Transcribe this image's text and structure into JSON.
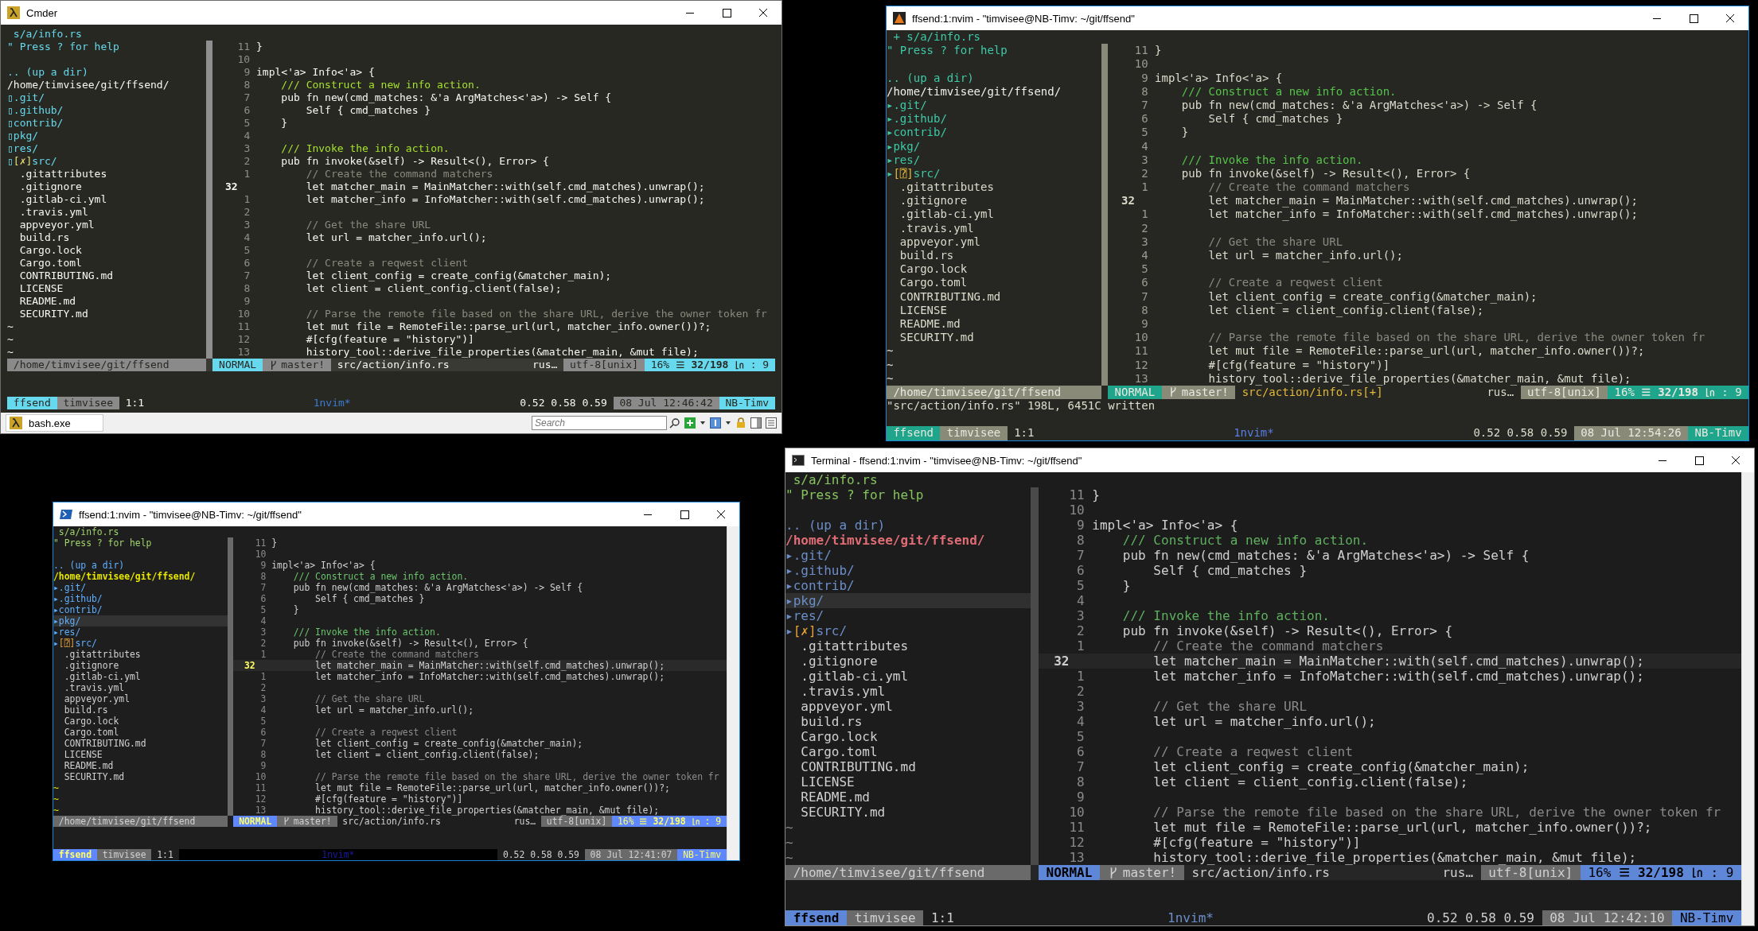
{
  "windows": [
    {
      "kind": "cmder",
      "title": "Cmder",
      "buffer_label": "s/a/info.rs",
      "tree": {
        "help": "\" Press ? for help",
        "parent": ".. (up a dir)",
        "root": "/home/timvisee/git/ffsend/",
        "items": [
          {
            "kind": "dir",
            "marker": "▯",
            "name": ".git/"
          },
          {
            "kind": "dir",
            "marker": "▯",
            "name": ".github/"
          },
          {
            "kind": "dir",
            "marker": "▯",
            "name": "contrib/"
          },
          {
            "kind": "dir",
            "marker": "▯",
            "name": "pkg/"
          },
          {
            "kind": "dir",
            "marker": "▯",
            "name": "res/"
          },
          {
            "kind": "dir",
            "marker": "▯",
            "flag": "[✗]",
            "name": "src/"
          },
          {
            "kind": "file",
            "name": ".gitattributes"
          },
          {
            "kind": "file",
            "name": ".gitignore"
          },
          {
            "kind": "file",
            "name": ".gitlab-ci.yml"
          },
          {
            "kind": "file",
            "name": ".travis.yml"
          },
          {
            "kind": "file",
            "name": "appveyor.yml"
          },
          {
            "kind": "file",
            "name": "build.rs"
          },
          {
            "kind": "file",
            "name": "Cargo.lock"
          },
          {
            "kind": "file",
            "name": "Cargo.toml"
          },
          {
            "kind": "file",
            "name": "CONTRIBUTING.md"
          },
          {
            "kind": "file",
            "name": "LICENSE"
          },
          {
            "kind": "file",
            "name": "README.md"
          },
          {
            "kind": "file",
            "name": "SECURITY.md"
          }
        ],
        "empty_lines": [
          "~",
          "~",
          "~"
        ]
      },
      "code": [
        {
          "number": "11",
          "kind": "code",
          "text": "}",
          "current": false
        },
        {
          "number": "10",
          "current": false
        },
        {
          "number": "9",
          "kind": "code",
          "text": "impl<'a> Info<'a> {",
          "current": false
        },
        {
          "number": "8",
          "kind": "doc",
          "text": "    /// Construct a new info action.",
          "current": false
        },
        {
          "number": "7",
          "kind": "code",
          "text": "    pub fn new(cmd_matches: &'a ArgMatches<'a>) -> Self {",
          "current": false
        },
        {
          "number": "6",
          "kind": "code",
          "text": "        Self { cmd_matches }",
          "current": false
        },
        {
          "number": "5",
          "kind": "code",
          "text": "    }",
          "current": false
        },
        {
          "number": "4",
          "current": false
        },
        {
          "number": "3",
          "kind": "doc",
          "text": "    /// Invoke the info action.",
          "current": false
        },
        {
          "number": "2",
          "kind": "code",
          "text": "    pub fn invoke(&self) -> Result<(), Error> {",
          "current": false
        },
        {
          "number": "1",
          "kind": "comment",
          "text": "        // Create the command matchers",
          "current": false
        },
        {
          "number": "32",
          "kind": "code",
          "text": "        let matcher_main = MainMatcher::with(self.cmd_matches).unwrap();",
          "current": true
        },
        {
          "number": "1",
          "kind": "code",
          "text": "        let matcher_info = InfoMatcher::with(self.cmd_matches).unwrap();",
          "current": false
        },
        {
          "number": "2",
          "current": false
        },
        {
          "number": "3",
          "kind": "comment",
          "text": "        // Get the share URL",
          "current": false
        },
        {
          "number": "4",
          "kind": "code",
          "text": "        let url = matcher_info.url();",
          "current": false
        },
        {
          "number": "5",
          "current": false
        },
        {
          "number": "6",
          "kind": "comment",
          "text": "        // Create a reqwest client",
          "current": false
        },
        {
          "number": "7",
          "kind": "code",
          "text": "        let client_config = create_config(&matcher_main);",
          "current": false
        },
        {
          "number": "8",
          "kind": "code",
          "text": "        let client = client_config.client(false);",
          "current": false
        },
        {
          "number": "9",
          "current": false
        },
        {
          "number": "10",
          "kind": "comment",
          "text": "        // Parse the remote file based on the share URL, derive the owner token fr",
          "current": false
        },
        {
          "number": "11",
          "kind": "code",
          "text": "        let mut file = RemoteFile::parse_url(url, matcher_info.owner())?;",
          "current": false
        },
        {
          "number": "12",
          "kind": "code",
          "text": "        #[cfg(feature = \"history\")]",
          "current": false
        },
        {
          "number": "13",
          "kind": "code",
          "text": "        history_tool::derive_file_properties(&matcher_main, &mut file);",
          "current": false
        }
      ],
      "status": {
        "tree_path": "/home/timvisee/git/ffsend",
        "mode": "NORMAL",
        "branch": "master!",
        "file": "src/action/info.rs",
        "filetype": "rus…",
        "encoding": "utf-8[unix]",
        "percent": "16%",
        "position": "32/198",
        "separator": ":",
        "column": "9"
      },
      "tmux": {
        "session": "ffsend",
        "user": "timvisee",
        "pane": "1:1",
        "window": "1nvim*",
        "load": "0.52 0.58 0.59",
        "clock": "08 Jul 12:46:42",
        "host": "NB-Timv"
      },
      "taskbar": {
        "tab": "bash.exe",
        "search_placeholder": "Search"
      }
    },
    {
      "kind": "mintty",
      "title": "ffsend:1:nvim - \"timvisee@NB-Timv: ~/git/ffsend\"",
      "buffer_label": "+ s/a/info.rs",
      "tree": {
        "help": "\" Press ? for help",
        "parent": ".. (up a dir)",
        "root": "/home/timvisee/git/ffsend/",
        "items": [
          {
            "kind": "dir",
            "marker": "▸",
            "name": ".git/"
          },
          {
            "kind": "dir",
            "marker": "▸",
            "name": ".github/"
          },
          {
            "kind": "dir",
            "marker": "▸",
            "name": "contrib/"
          },
          {
            "kind": "dir",
            "marker": "▸",
            "name": "pkg/"
          },
          {
            "kind": "dir",
            "marker": "▸",
            "name": "res/"
          },
          {
            "kind": "dir",
            "marker": "▸",
            "flag": "[⍰]",
            "name": "src/"
          },
          {
            "kind": "file",
            "name": ".gitattributes"
          },
          {
            "kind": "file",
            "name": ".gitignore"
          },
          {
            "kind": "file",
            "name": ".gitlab-ci.yml"
          },
          {
            "kind": "file",
            "name": ".travis.yml"
          },
          {
            "kind": "file",
            "name": "appveyor.yml"
          },
          {
            "kind": "file",
            "name": "build.rs"
          },
          {
            "kind": "file",
            "name": "Cargo.lock"
          },
          {
            "kind": "file",
            "name": "Cargo.toml"
          },
          {
            "kind": "file",
            "name": "CONTRIBUTING.md"
          },
          {
            "kind": "file",
            "name": "LICENSE"
          },
          {
            "kind": "file",
            "name": "README.md"
          },
          {
            "kind": "file",
            "name": "SECURITY.md"
          }
        ],
        "empty_lines": [
          "~",
          "~",
          "~"
        ]
      },
      "code": [
        {
          "number": "11",
          "kind": "code",
          "text": "}",
          "current": false
        },
        {
          "number": "10",
          "current": false
        },
        {
          "number": "9",
          "kind": "code",
          "text": "impl<'a> Info<'a> {",
          "current": false
        },
        {
          "number": "8",
          "kind": "doc",
          "text": "    /// Construct a new info action.",
          "current": false
        },
        {
          "number": "7",
          "kind": "code",
          "text": "    pub fn new(cmd_matches: &'a ArgMatches<'a>) -> Self {",
          "current": false
        },
        {
          "number": "6",
          "kind": "code",
          "text": "        Self { cmd_matches }",
          "current": false
        },
        {
          "number": "5",
          "kind": "code",
          "text": "    }",
          "current": false
        },
        {
          "number": "4",
          "current": false
        },
        {
          "number": "3",
          "kind": "doc",
          "text": "    /// Invoke the info action.",
          "current": false
        },
        {
          "number": "2",
          "kind": "code",
          "text": "    pub fn invoke(&self) -> Result<(), Error> {",
          "current": false
        },
        {
          "number": "1",
          "kind": "comment",
          "text": "        // Create the command matchers",
          "current": false
        },
        {
          "number": "32",
          "kind": "code",
          "text": "        let matcher_main = MainMatcher::with(self.cmd_matches).unwrap();",
          "current": true
        },
        {
          "number": "1",
          "kind": "code",
          "text": "        let matcher_info = InfoMatcher::with(self.cmd_matches).unwrap();",
          "current": false
        },
        {
          "number": "2",
          "current": false
        },
        {
          "number": "3",
          "kind": "comment",
          "text": "        // Get the share URL",
          "current": false
        },
        {
          "number": "4",
          "kind": "code",
          "text": "        let url = matcher_info.url();",
          "current": false
        },
        {
          "number": "5",
          "current": false
        },
        {
          "number": "6",
          "kind": "comment",
          "text": "        // Create a reqwest client",
          "current": false
        },
        {
          "number": "7",
          "kind": "code",
          "text": "        let client_config = create_config(&matcher_main);",
          "current": false
        },
        {
          "number": "8",
          "kind": "code",
          "text": "        let client = client_config.client(false);",
          "current": false
        },
        {
          "number": "9",
          "current": false
        },
        {
          "number": "10",
          "kind": "comment",
          "text": "        // Parse the remote file based on the share URL, derive the owner token fr",
          "current": false
        },
        {
          "number": "11",
          "kind": "code",
          "text": "        let mut file = RemoteFile::parse_url(url, matcher_info.owner())?;",
          "current": false
        },
        {
          "number": "12",
          "kind": "code",
          "text": "        #[cfg(feature = \"history\")]",
          "current": false
        },
        {
          "number": "13",
          "kind": "code",
          "text": "        history_tool::derive_file_properties(&matcher_main, &mut file);",
          "current": false
        }
      ],
      "status": {
        "tree_path": "/home/timvisee/git/ffsend",
        "mode": "NORMAL",
        "branch": "master!",
        "file": "src/action/info.rs[+]",
        "filetype": "rus…",
        "encoding": "utf-8[unix]",
        "percent": "16%",
        "position": "32/198",
        "separator": ":",
        "column": "9"
      },
      "command_line": "\"src/action/info.rs\" 198L, 6451C written",
      "tmux": {
        "session": "ffsend",
        "user": "timvisee",
        "pane": "1:1",
        "window": "1nvim*",
        "load": "0.52 0.58 0.59",
        "clock": "08 Jul 12:54:26",
        "host": "NB-Timv"
      }
    },
    {
      "kind": "powershell",
      "title": "ffsend:1:nvim - \"timvisee@NB-Timv: ~/git/ffsend\"",
      "buffer_label": "s/a/info.rs",
      "tree": {
        "help": "\" Press ? for help",
        "parent": ".. (up a dir)",
        "root": "/home/timvisee/git/ffsend/",
        "items": [
          {
            "kind": "dir",
            "marker": "▸",
            "name": ".git/",
            "selected": false
          },
          {
            "kind": "dir",
            "marker": "▸",
            "name": ".github/",
            "selected": false
          },
          {
            "kind": "dir",
            "marker": "▸",
            "name": "contrib/",
            "selected": false
          },
          {
            "kind": "dir",
            "marker": "▸",
            "name": "pkg/",
            "selected": true
          },
          {
            "kind": "dir",
            "marker": "▸",
            "name": "res/",
            "selected": false
          },
          {
            "kind": "dir",
            "marker": "▸",
            "flag": "[⍰]",
            "name": "src/",
            "selected": false
          },
          {
            "kind": "file",
            "name": ".gitattributes",
            "selected": false
          },
          {
            "kind": "file",
            "name": ".gitignore",
            "selected": false
          },
          {
            "kind": "file",
            "name": ".gitlab-ci.yml",
            "selected": false
          },
          {
            "kind": "file",
            "name": ".travis.yml",
            "selected": false
          },
          {
            "kind": "file",
            "name": "appveyor.yml",
            "selected": false
          },
          {
            "kind": "file",
            "name": "build.rs",
            "selected": false
          },
          {
            "kind": "file",
            "name": "Cargo.lock",
            "selected": false
          },
          {
            "kind": "file",
            "name": "Cargo.toml",
            "selected": false
          },
          {
            "kind": "file",
            "name": "CONTRIBUTING.md",
            "selected": false
          },
          {
            "kind": "file",
            "name": "LICENSE",
            "selected": false
          },
          {
            "kind": "file",
            "name": "README.md",
            "selected": false
          },
          {
            "kind": "file",
            "name": "SECURITY.md",
            "selected": false
          }
        ],
        "empty_lines": [
          "~",
          "~",
          "~"
        ]
      },
      "code": [
        {
          "number": "11",
          "kind": "code",
          "text": "}",
          "current": false
        },
        {
          "number": "10",
          "current": false
        },
        {
          "number": "9",
          "kind": "code",
          "text": "impl<'a> Info<'a> {",
          "current": false
        },
        {
          "number": "8",
          "kind": "doc",
          "text": "    /// Construct a new info action.",
          "current": false
        },
        {
          "number": "7",
          "kind": "code",
          "text": "    pub fn new(cmd_matches: &'a ArgMatches<'a>) -> Self {",
          "current": false
        },
        {
          "number": "6",
          "kind": "code",
          "text": "        Self { cmd_matches }",
          "current": false
        },
        {
          "number": "5",
          "kind": "code",
          "text": "    }",
          "current": false
        },
        {
          "number": "4",
          "current": false
        },
        {
          "number": "3",
          "kind": "doc",
          "text": "    /// Invoke the info action.",
          "current": false
        },
        {
          "number": "2",
          "kind": "code",
          "text": "    pub fn invoke(&self) -> Result<(), Error> {",
          "current": false
        },
        {
          "number": "1",
          "kind": "comment",
          "text": "        // Create the command matchers",
          "current": false
        },
        {
          "number": "32",
          "kind": "code",
          "text": "        let matcher_main = MainMatcher::with(self.cmd_matches).unwrap();",
          "current": true
        },
        {
          "number": "1",
          "kind": "code",
          "text": "        let matcher_info = InfoMatcher::with(self.cmd_matches).unwrap();",
          "current": false
        },
        {
          "number": "2",
          "current": false
        },
        {
          "number": "3",
          "kind": "comment",
          "text": "        // Get the share URL",
          "current": false
        },
        {
          "number": "4",
          "kind": "code",
          "text": "        let url = matcher_info.url();",
          "current": false
        },
        {
          "number": "5",
          "current": false
        },
        {
          "number": "6",
          "kind": "comment",
          "text": "        // Create a reqwest client",
          "current": false
        },
        {
          "number": "7",
          "kind": "code",
          "text": "        let client_config = create_config(&matcher_main);",
          "current": false
        },
        {
          "number": "8",
          "kind": "code",
          "text": "        let client = client_config.client(false);",
          "current": false
        },
        {
          "number": "9",
          "current": false
        },
        {
          "number": "10",
          "kind": "comment",
          "text": "        // Parse the remote file based on the share URL, derive the owner token fr",
          "current": false
        },
        {
          "number": "11",
          "kind": "code",
          "text": "        let mut file = RemoteFile::parse_url(url, matcher_info.owner())?;",
          "current": false
        },
        {
          "number": "12",
          "kind": "code",
          "text": "        #[cfg(feature = \"history\")]",
          "current": false
        },
        {
          "number": "13",
          "kind": "code",
          "text": "        history_tool::derive_file_properties(&matcher_main, &mut file);",
          "current": false
        }
      ],
      "status": {
        "tree_path": "/home/timvisee/git/ffsend",
        "mode": "NORMAL",
        "branch": "master!",
        "file": "src/action/info.rs",
        "filetype": "rus…",
        "encoding": "utf-8[unix]",
        "percent": "16%",
        "position": "32/198",
        "separator": ":",
        "column": "9"
      },
      "tmux": {
        "session": "ffsend",
        "user": "timvisee",
        "pane": "1:1",
        "window": "1nvim*",
        "load": "0.52 0.58 0.59",
        "clock": "08 Jul 12:41:07",
        "host": "NB-Timv"
      }
    },
    {
      "kind": "xfce",
      "title": "Terminal - ffsend:1:nvim - \"timvisee@NB-Timv: ~/git/ffsend\"",
      "buffer_label": "s/a/info.rs",
      "tree": {
        "help": "\" Press ? for help",
        "parent": ".. (up a dir)",
        "root": "/home/timvisee/git/ffsend/",
        "items": [
          {
            "kind": "dir",
            "marker": "▸",
            "name": ".git/",
            "selected": false
          },
          {
            "kind": "dir",
            "marker": "▸",
            "name": ".github/",
            "selected": false
          },
          {
            "kind": "dir",
            "marker": "▸",
            "name": "contrib/",
            "selected": false
          },
          {
            "kind": "dir",
            "marker": "▸",
            "name": "pkg/",
            "selected": true
          },
          {
            "kind": "dir",
            "marker": "▸",
            "name": "res/",
            "selected": false
          },
          {
            "kind": "dir",
            "marker": "▸",
            "flag": "[✗]",
            "name": "src/",
            "selected": false
          },
          {
            "kind": "file",
            "name": ".gitattributes",
            "selected": false
          },
          {
            "kind": "file",
            "name": ".gitignore",
            "selected": false
          },
          {
            "kind": "file",
            "name": ".gitlab-ci.yml",
            "selected": false
          },
          {
            "kind": "file",
            "name": ".travis.yml",
            "selected": false
          },
          {
            "kind": "file",
            "name": "appveyor.yml",
            "selected": false
          },
          {
            "kind": "file",
            "name": "build.rs",
            "selected": false
          },
          {
            "kind": "file",
            "name": "Cargo.lock",
            "selected": false
          },
          {
            "kind": "file",
            "name": "Cargo.toml",
            "selected": false
          },
          {
            "kind": "file",
            "name": "CONTRIBUTING.md",
            "selected": false
          },
          {
            "kind": "file",
            "name": "LICENSE",
            "selected": false
          },
          {
            "kind": "file",
            "name": "README.md",
            "selected": false
          },
          {
            "kind": "file",
            "name": "SECURITY.md",
            "selected": false
          }
        ],
        "empty_lines": [
          "~",
          "~",
          "~"
        ]
      },
      "code": [
        {
          "number": "11",
          "kind": "code",
          "text": "}",
          "current": false
        },
        {
          "number": "10",
          "current": false
        },
        {
          "number": "9",
          "kind": "code",
          "text": "impl<'a> Info<'a> {",
          "current": false
        },
        {
          "number": "8",
          "kind": "doc",
          "text": "    /// Construct a new info action.",
          "current": false
        },
        {
          "number": "7",
          "kind": "code",
          "text": "    pub fn new(cmd_matches: &'a ArgMatches<'a>) -> Self {",
          "current": false
        },
        {
          "number": "6",
          "kind": "code",
          "text": "        Self { cmd_matches }",
          "current": false
        },
        {
          "number": "5",
          "kind": "code",
          "text": "    }",
          "current": false
        },
        {
          "number": "4",
          "current": false
        },
        {
          "number": "3",
          "kind": "doc",
          "text": "    /// Invoke the info action.",
          "current": false
        },
        {
          "number": "2",
          "kind": "code",
          "text": "    pub fn invoke(&self) -> Result<(), Error> {",
          "current": false
        },
        {
          "number": "1",
          "kind": "comment",
          "text": "        // Create the command matchers",
          "current": false
        },
        {
          "number": "32",
          "kind": "code",
          "text": "        let matcher_main = MainMatcher::with(self.cmd_matches).unwrap();",
          "current": true
        },
        {
          "number": "1",
          "kind": "code",
          "text": "        let matcher_info = InfoMatcher::with(self.cmd_matches).unwrap();",
          "current": false
        },
        {
          "number": "2",
          "current": false
        },
        {
          "number": "3",
          "kind": "comment",
          "text": "        // Get the share URL",
          "current": false
        },
        {
          "number": "4",
          "kind": "code",
          "text": "        let url = matcher_info.url();",
          "current": false
        },
        {
          "number": "5",
          "current": false
        },
        {
          "number": "6",
          "kind": "comment",
          "text": "        // Create a reqwest client",
          "current": false
        },
        {
          "number": "7",
          "kind": "code",
          "text": "        let client_config = create_config(&matcher_main);",
          "current": false
        },
        {
          "number": "8",
          "kind": "code",
          "text": "        let client = client_config.client(false);",
          "current": false
        },
        {
          "number": "9",
          "current": false
        },
        {
          "number": "10",
          "kind": "comment",
          "text": "        // Parse the remote file based on the share URL, derive the owner token fr",
          "current": false
        },
        {
          "number": "11",
          "kind": "code",
          "text": "        let mut file = RemoteFile::parse_url(url, matcher_info.owner())?;",
          "current": false
        },
        {
          "number": "12",
          "kind": "code",
          "text": "        #[cfg(feature = \"history\")]",
          "current": false
        },
        {
          "number": "13",
          "kind": "code",
          "text": "        history_tool::derive_file_properties(&matcher_main, &mut file);",
          "current": false
        }
      ],
      "status": {
        "tree_path": "/home/timvisee/git/ffsend",
        "mode": "NORMAL",
        "branch": "master!",
        "file": "src/action/info.rs",
        "filetype": "rus…",
        "encoding": "utf-8[unix]",
        "percent": "16%",
        "position": "32/198",
        "separator": ":",
        "column": "9"
      },
      "tmux": {
        "session": "ffsend",
        "user": "timvisee",
        "pane": "1:1",
        "window": "1nvim*",
        "load": "0.52 0.58 0.59",
        "clock": "08 Jul 12:42:10",
        "host": "NB-Timv"
      }
    }
  ]
}
